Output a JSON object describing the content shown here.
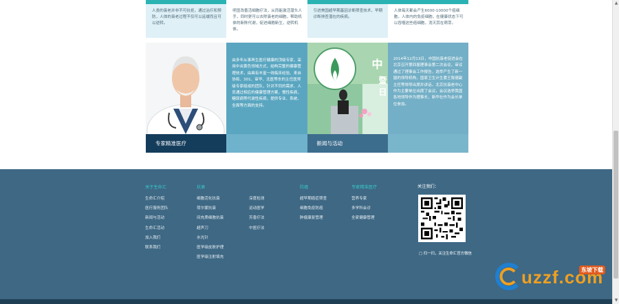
{
  "top_cards": [
    "人类的衰老并非不可抗拒，通过治疗和预防，人体的衰老过程不仅可以延缓而且可以逆转。",
    "明显改善活细胞疗法，从而能激活潜头人手，同时更可以去除衰老的细胞，帮助机体的新陈代谢，促进细胞新生，逆转机体。",
    "引进美国超早期基因诊断筛查技术，早期诊断排查潜在的疾病。",
    "人体每天都会产生6000-10000个癌细胞，人体内的免疫细胞，在健康状态下可以吞噬这些癌细胞，消灭其在萌芽。"
  ],
  "panels": [
    {
      "caption": "专家精准医疗"
    },
    {
      "text": "由多年从事再生医疗健康的顶级专家，采用中央黄色领域方式，结构完整的健康管理技术，由具有丰富一线临床经验、来自协和、301、审华、北医等东的主任医师级专家组成的团队，针对不同的需求、人员通过相应的健康管理方案，慢性疾病，糖尿病等代谢性疾病，提供专业、系统、全面等方面的支持。"
    },
    {
      "caption": "新闻与活动"
    },
    {
      "text": "2014年12月13日，中国抗衰老促进会在北京召开第四届理事会第二次会议，审议通过了理事会工作报告，选举产生了新一届的领导机构，国家卫生计生委王陇德副主任等领导出席并讲话，北京抗衰老中心作为主要单位出席了会议，会议选举我国各地领导作为理事长，新华社作为会长单位参加。"
    }
  ],
  "news_image": {
    "sign_char": "中",
    "sign_char_2": "暨日"
  },
  "footer": {
    "col1": {
      "head": "关于生命汇",
      "items": [
        "生命汇介绍",
        "医疗服务团队",
        "新闻与活动",
        "生命汇活动",
        "加入我们",
        "联系我们"
      ]
    },
    "col2": {
      "head": "抗衰",
      "items": [
        "细胞活化抗衰",
        "荷尔蒙抗衰",
        "间充质细胞抗衰",
        "超声刀",
        "水光针",
        "医学级皮肤护理",
        "医学级注射填充"
      ]
    },
    "col3": {
      "head": "",
      "items": [
        "深度检测",
        "运动医学",
        "芳香疗法",
        "中医疗法"
      ]
    },
    "col4": {
      "head": "防癌",
      "items": [
        "超早期癌症筛查",
        "细胞免疫防癌",
        "肿瘤康复管理"
      ]
    },
    "col5": {
      "head": "专家精准医疗",
      "items": [
        "营养专家",
        "多学科会诊",
        "全家健康管理"
      ]
    },
    "follow_title": "关注我们：",
    "qr_caption": "□ 扫一扫，关注生命汇官方微信"
  },
  "watermark": {
    "text": "uzzf.com",
    "badge": "东坡下载"
  },
  "colors": {
    "teal_accent": "#2bb3b3",
    "footer_bg": "#3e6884",
    "footer_heading": "#38c7c9",
    "panel_blue": "#5aa6c1",
    "caption_navy": "#143d5c",
    "watermark_orange": "#f0a020"
  }
}
